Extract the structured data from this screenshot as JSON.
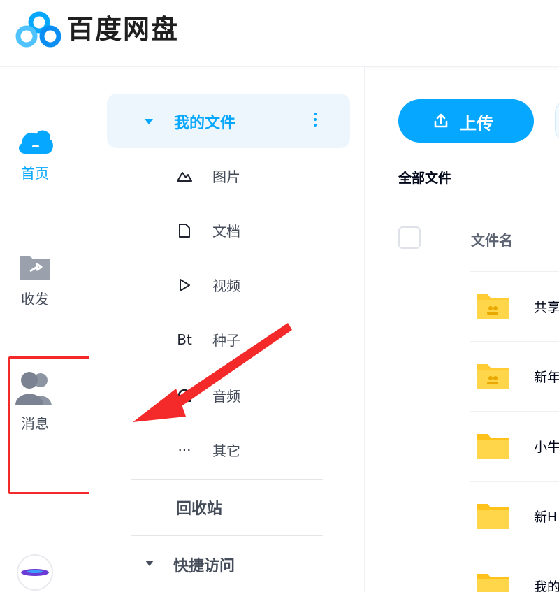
{
  "app": {
    "brand": "百度网盘"
  },
  "rail": {
    "items": [
      {
        "label": "首页",
        "icon": "cloud-icon",
        "active": true
      },
      {
        "label": "收发",
        "icon": "share-folder-icon",
        "active": false
      },
      {
        "label": "消息",
        "icon": "people-icon",
        "active": false
      },
      {
        "label": "",
        "icon": "ai-orb-icon",
        "active": false
      }
    ]
  },
  "nav": {
    "my_files": "我的文件",
    "sub_items": [
      {
        "label": "图片",
        "icon": "image-icon"
      },
      {
        "label": "文档",
        "icon": "document-icon"
      },
      {
        "label": "视频",
        "icon": "video-icon"
      },
      {
        "label": "种子",
        "icon": "bt-icon",
        "glyph": "Bt"
      },
      {
        "label": "音频",
        "icon": "audio-icon"
      },
      {
        "label": "其它",
        "icon": "more-icon",
        "glyph": "···"
      }
    ],
    "recycle": "回收站",
    "quick_access": "快捷访问"
  },
  "main": {
    "upload_label": "上传",
    "breadcrumb": "全部文件",
    "column_name": "文件名",
    "files": [
      {
        "name": "共享",
        "type": "shared-folder"
      },
      {
        "name": "新年",
        "type": "shared-folder"
      },
      {
        "name": "小牛",
        "type": "folder"
      },
      {
        "name": "新H",
        "type": "folder"
      },
      {
        "name": "我的",
        "type": "folder"
      }
    ]
  },
  "colors": {
    "accent": "#06a7ff",
    "highlight": "#f42a2a",
    "folder": "#ffcc33",
    "text": "#454d5a"
  }
}
